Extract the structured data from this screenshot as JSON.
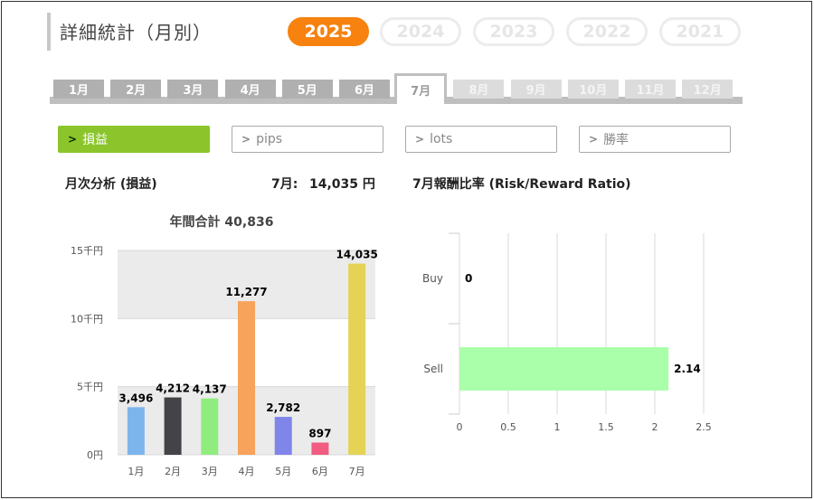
{
  "page": {
    "title": "詳細統計（月別）"
  },
  "years": [
    {
      "label": "2025",
      "active": true
    },
    {
      "label": "2024",
      "active": false
    },
    {
      "label": "2023",
      "active": false
    },
    {
      "label": "2022",
      "active": false
    },
    {
      "label": "2021",
      "active": false
    }
  ],
  "months": [
    {
      "label": "1月",
      "state": "available"
    },
    {
      "label": "2月",
      "state": "available"
    },
    {
      "label": "3月",
      "state": "available"
    },
    {
      "label": "4月",
      "state": "available"
    },
    {
      "label": "5月",
      "state": "available"
    },
    {
      "label": "6月",
      "state": "available"
    },
    {
      "label": "7月",
      "state": "active"
    },
    {
      "label": "8月",
      "state": "disabled"
    },
    {
      "label": "9月",
      "state": "disabled"
    },
    {
      "label": "10月",
      "state": "disabled"
    },
    {
      "label": "11月",
      "state": "disabled"
    },
    {
      "label": "12月",
      "state": "disabled"
    }
  ],
  "metrics": [
    {
      "label": "損益",
      "active": true
    },
    {
      "label": "pips",
      "active": false
    },
    {
      "label": "lots",
      "active": false
    },
    {
      "label": "勝率",
      "active": false
    }
  ],
  "monthly_analysis": {
    "heading": "月次分析 (損益)",
    "current_month": "7月:",
    "current_value": "14,035 円"
  },
  "ratio_heading": "7月報酬比率 (Risk/Reward Ratio)",
  "chart_data": [
    {
      "type": "bar",
      "title": "年間合計 40,836",
      "categories": [
        "1月",
        "2月",
        "3月",
        "4月",
        "5月",
        "6月",
        "7月"
      ],
      "values": [
        3496,
        4212,
        4137,
        11277,
        2782,
        897,
        14035
      ],
      "value_labels": [
        "3,496",
        "4,212",
        "4,137",
        "11,277",
        "2,782",
        "897",
        "14,035"
      ],
      "colors": [
        "#7cb5ec",
        "#434348",
        "#90ed7d",
        "#f7a35c",
        "#8085e9",
        "#f15c80",
        "#e4d354"
      ],
      "ylim": [
        0,
        15000
      ],
      "yticks": [
        0,
        5000,
        10000,
        15000
      ],
      "ytick_labels": [
        "0円",
        "5千円",
        "10千円",
        "15千円"
      ],
      "grid": true
    },
    {
      "type": "bar",
      "orientation": "horizontal",
      "categories": [
        "Buy",
        "Sell"
      ],
      "values": [
        0,
        2.14
      ],
      "value_labels": [
        "0",
        "2.14"
      ],
      "color": "#aaffaa",
      "xlim": [
        0,
        2.5
      ],
      "xticks": [
        0,
        0.5,
        1,
        1.5,
        2,
        2.5
      ],
      "xtick_labels": [
        "0",
        "0.5",
        "1",
        "1.5",
        "2",
        "2.5"
      ],
      "grid": true
    }
  ]
}
